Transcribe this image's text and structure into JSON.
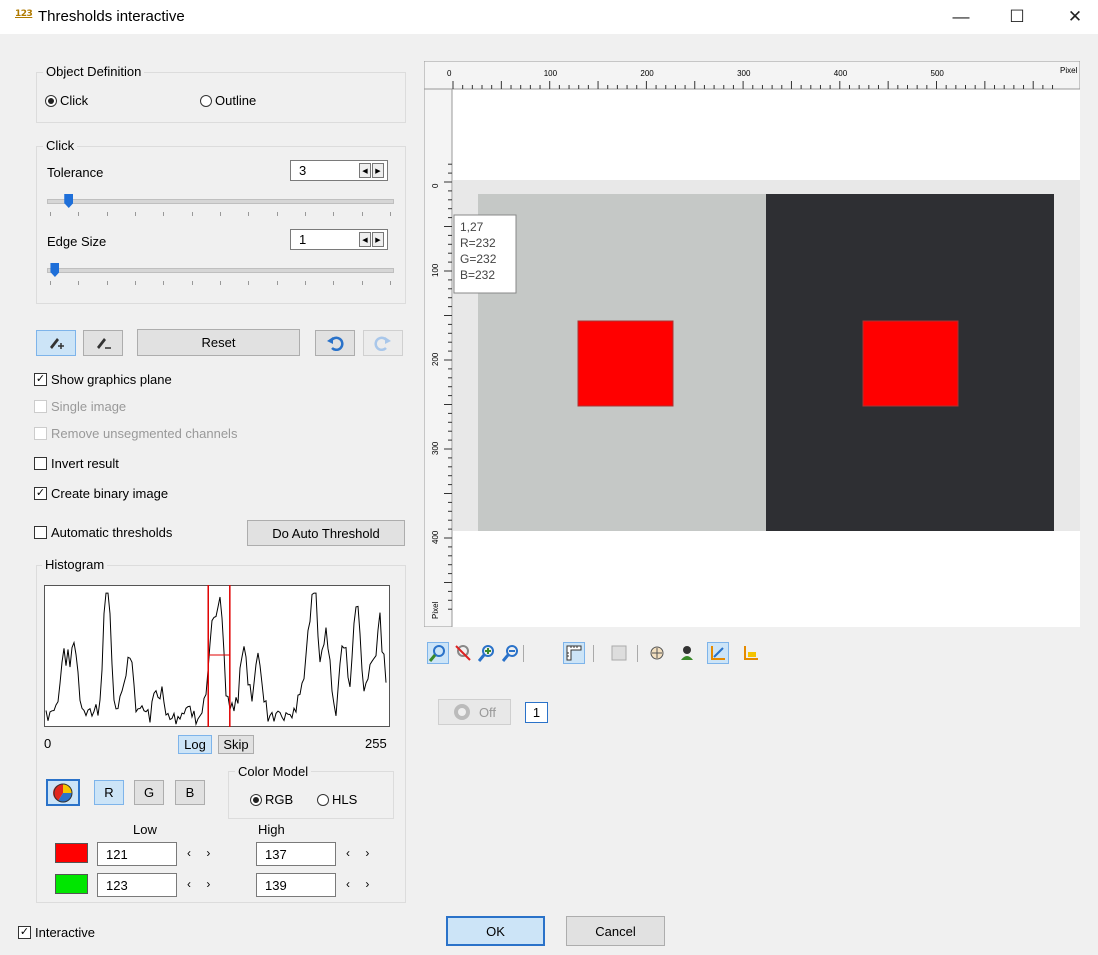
{
  "window": {
    "title": "Thresholds interactive",
    "icon": "123-icon",
    "minimize": "—",
    "maximize": "☐",
    "close": "✕"
  },
  "object_definition": {
    "label": "Object Definition",
    "click_label": "Click",
    "outline_label": "Outline",
    "selected": "click"
  },
  "click_group": {
    "label": "Click",
    "tolerance_label": "Tolerance",
    "tolerance_value": "3",
    "tolerance_slider_fraction": 0.05,
    "edge_size_label": "Edge Size",
    "edge_size_value": "1",
    "edge_size_slider_fraction": 0.01
  },
  "toolbar": {
    "reset_label": "Reset",
    "add_icon": "pencil-plus-icon",
    "remove_icon": "pencil-minus-icon",
    "undo_icon": "undo-icon",
    "redo_icon": "redo-icon"
  },
  "options": {
    "show_graphics_plane": {
      "label": "Show graphics plane",
      "checked": true
    },
    "single_image": {
      "label": "Single image",
      "checked": false,
      "disabled": true
    },
    "remove_unsegmented": {
      "label": "Remove unsegmented channels",
      "checked": false,
      "disabled": true
    },
    "invert_result": {
      "label": "Invert result",
      "checked": false
    },
    "create_binary_image": {
      "label": "Create binary image",
      "checked": true
    },
    "automatic_thresholds": {
      "label": "Automatic thresholds",
      "checked": false
    },
    "auto_threshold_button": "Do Auto Threshold"
  },
  "histogram": {
    "label": "Histogram",
    "min_label": "0",
    "max_label": "255",
    "log_label": "Log",
    "skip_label": "Skip",
    "low": 121,
    "high": 137
  },
  "channels": {
    "r": "R",
    "g": "G",
    "b": "B",
    "active_icon": "color-wheel-icon",
    "color_model_label": "Color Model",
    "rgb_label": "RGB",
    "hls_label": "HLS",
    "selected_model": "rgb"
  },
  "thresholds": {
    "low_label": "Low",
    "high_label": "High",
    "arrows": "‹ ›",
    "rows": [
      {
        "color": "#ff0000",
        "low": "121",
        "high": "137"
      },
      {
        "color": "#00e600",
        "low": "123",
        "high": "139"
      }
    ]
  },
  "viewer": {
    "ruler_unit": "Pixel",
    "x_ticks": [
      "0",
      "100",
      "200",
      "300",
      "400",
      "500"
    ],
    "y_ticks": [
      "0",
      "100",
      "200",
      "300",
      "400"
    ],
    "tooltip": {
      "line1": "1,27",
      "line2": "R=232",
      "line3": "G=232",
      "line4": "B=232"
    },
    "left_bg": "#c5c8c6",
    "right_bg": "#2e2f33",
    "square_color": "#ff0000"
  },
  "viewer_toolbar": {
    "icons": [
      "zoom-fit-icon",
      "zoom-off-icon",
      "zoom-in-icon",
      "zoom-out-icon",
      "ruler-icon",
      "frame-icon",
      "crosshair-icon",
      "palette-icon",
      "axis-icon",
      "chart-icon"
    ]
  },
  "playback": {
    "off_label": "Off",
    "frame": "1"
  },
  "footer": {
    "interactive_label": "Interactive",
    "interactive_checked": true,
    "ok_label": "OK",
    "cancel_label": "Cancel"
  }
}
